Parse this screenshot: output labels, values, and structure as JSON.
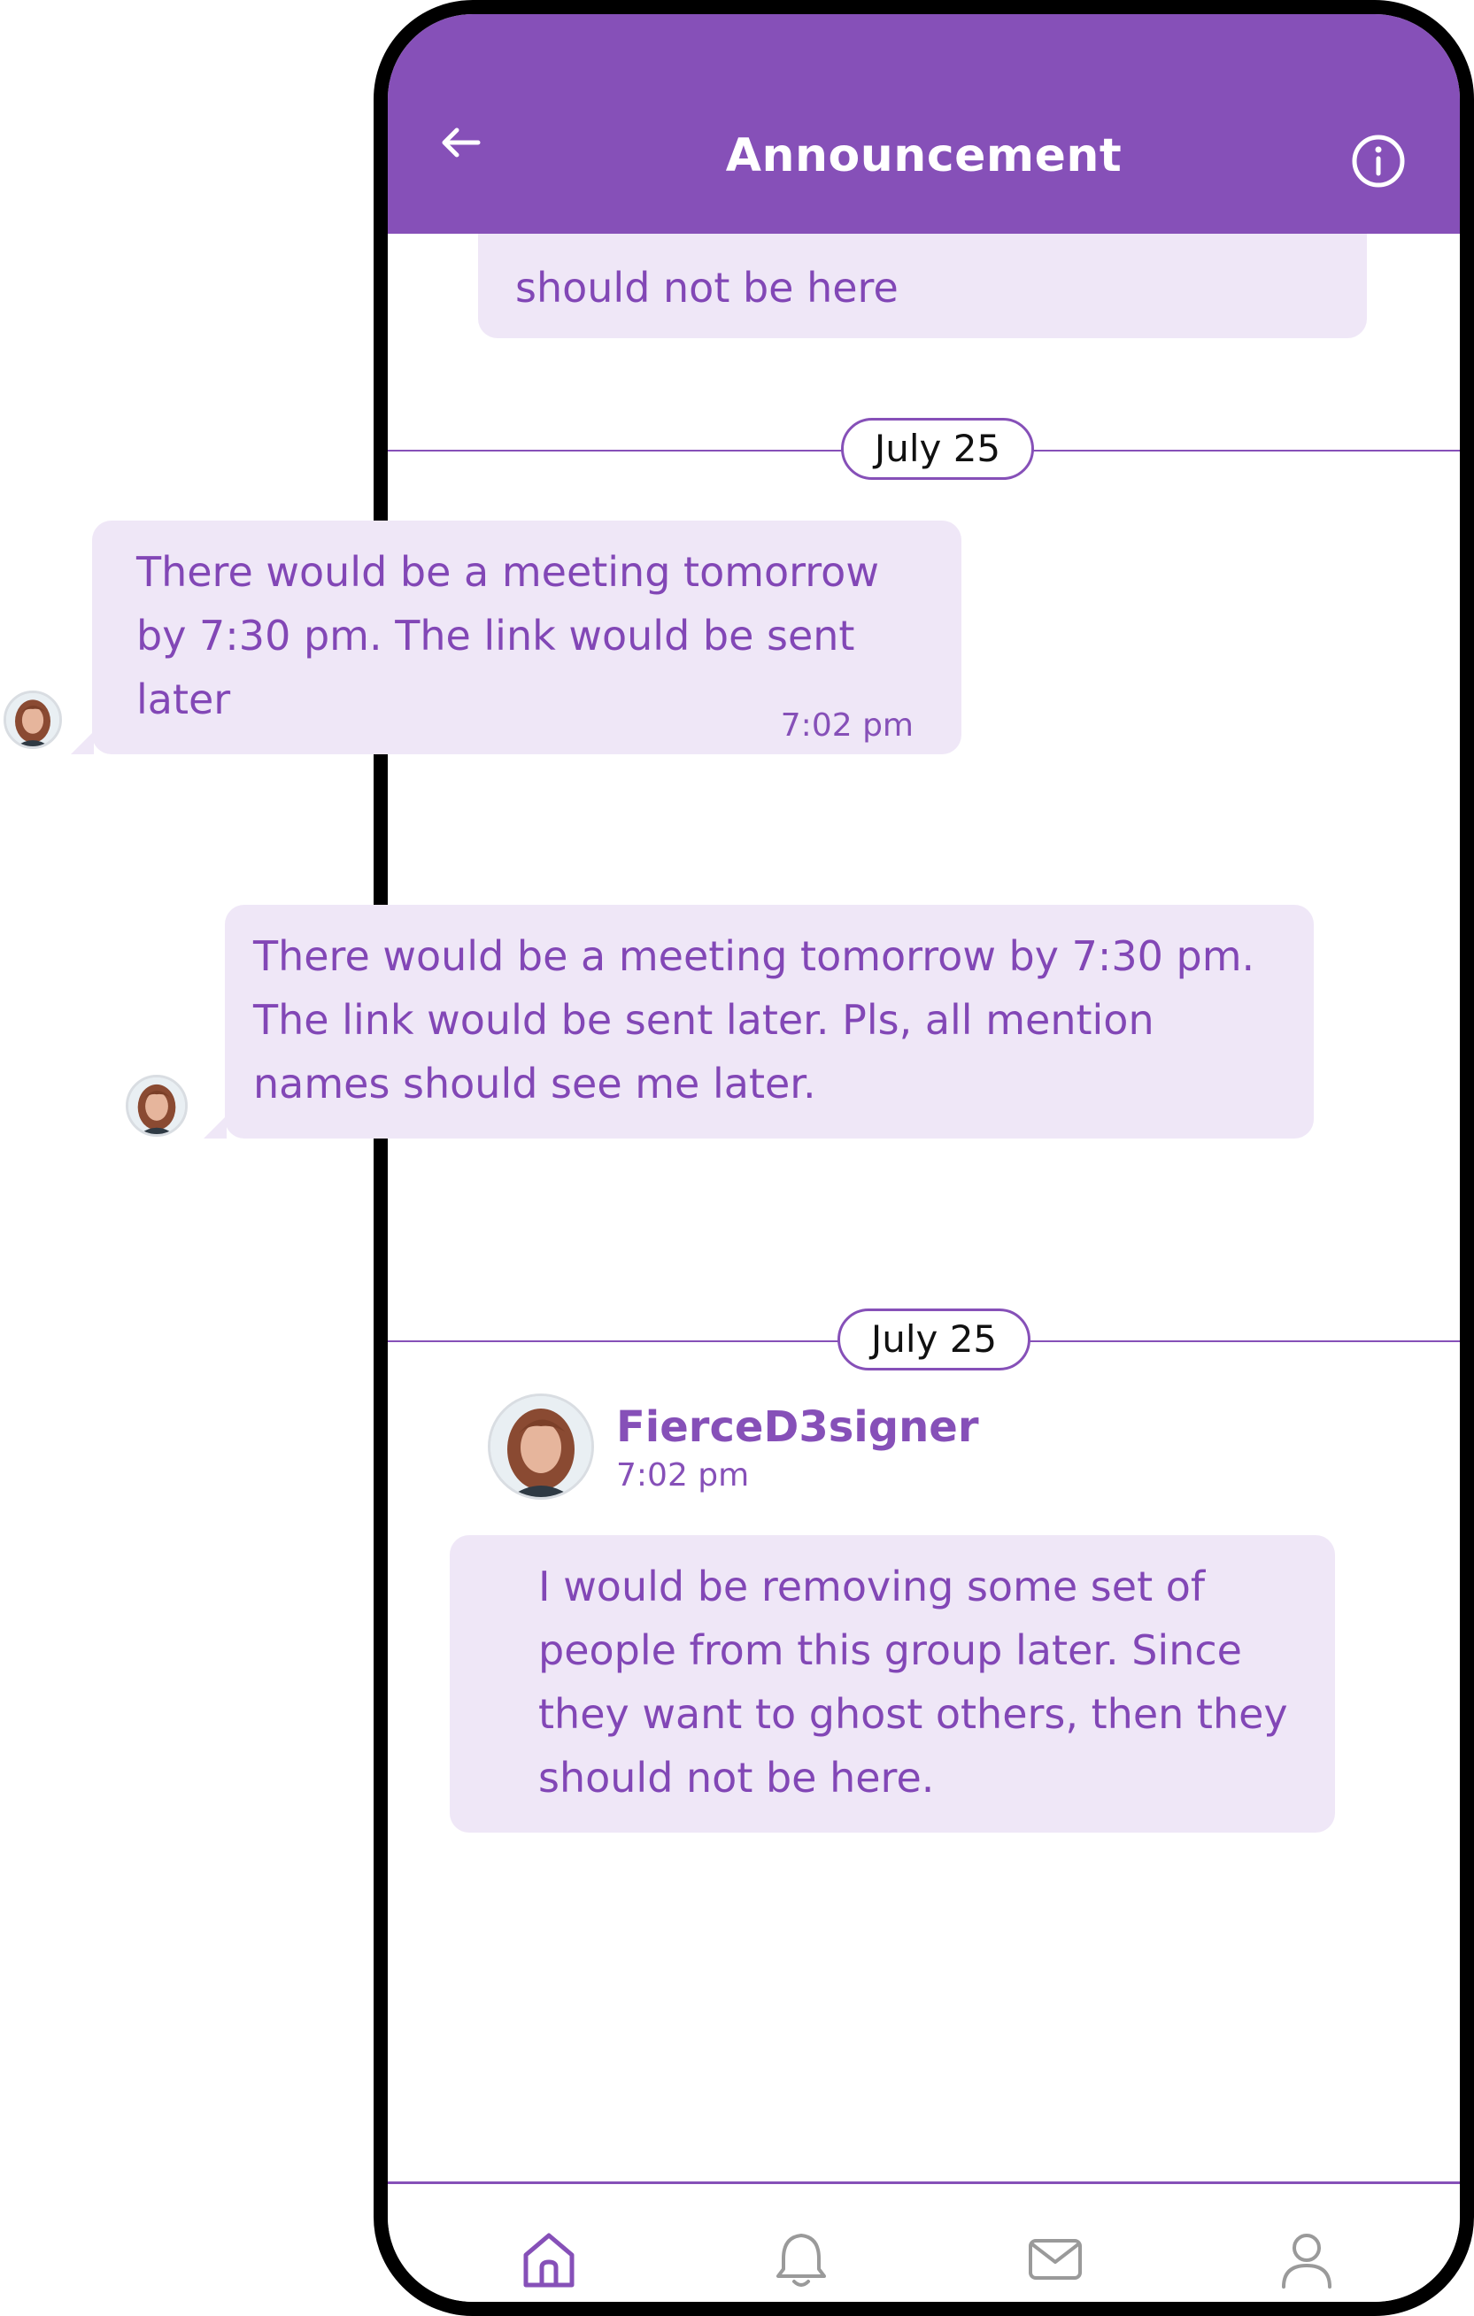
{
  "header": {
    "title": "Announcement",
    "back_icon": "arrow-left-icon",
    "info_icon": "info-circle-icon"
  },
  "messages": [
    {
      "text": "should not be here"
    },
    {
      "text": "There would be a meeting tomorrow by 7:30 pm. The link would be sent later",
      "time": "7:02 pm"
    },
    {
      "text": "There would be a meeting tomorrow by 7:30 pm. The link would be sent later. Pls, all mention names should see me later."
    },
    {
      "sender": "FierceD3signer",
      "time": "7:02 pm",
      "text": "I would be removing some set of people from this group later. Since they want to ghost others, then they should not be here."
    }
  ],
  "dates": [
    "July 25",
    "July 25"
  ],
  "bottom_nav": [
    {
      "icon": "home-icon"
    },
    {
      "icon": "bell-icon"
    },
    {
      "icon": "mail-icon"
    },
    {
      "icon": "user-icon"
    }
  ],
  "colors": {
    "accent": "#8650b8",
    "bubble_bg": "#efe7f7",
    "text_purple": "#8247b6",
    "frame": "#000000"
  }
}
